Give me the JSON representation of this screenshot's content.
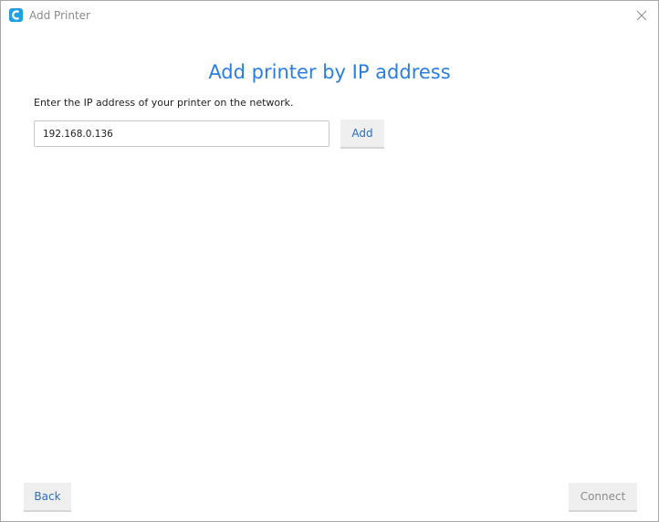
{
  "window": {
    "title": "Add Printer",
    "app_icon": "cura-icon",
    "close_icon": "close-icon"
  },
  "main": {
    "heading": "Add printer by IP address",
    "instruction": "Enter the IP address of your printer on the network.",
    "ip_input": {
      "value": "192.168.0.136",
      "placeholder": ""
    },
    "add_label": "Add"
  },
  "footer": {
    "back_label": "Back",
    "connect_label": "Connect",
    "connect_enabled": false
  },
  "colors": {
    "accent": "#2a7de1",
    "app_icon": "#1ea0e3",
    "disabled_text": "#8c8c8c"
  }
}
